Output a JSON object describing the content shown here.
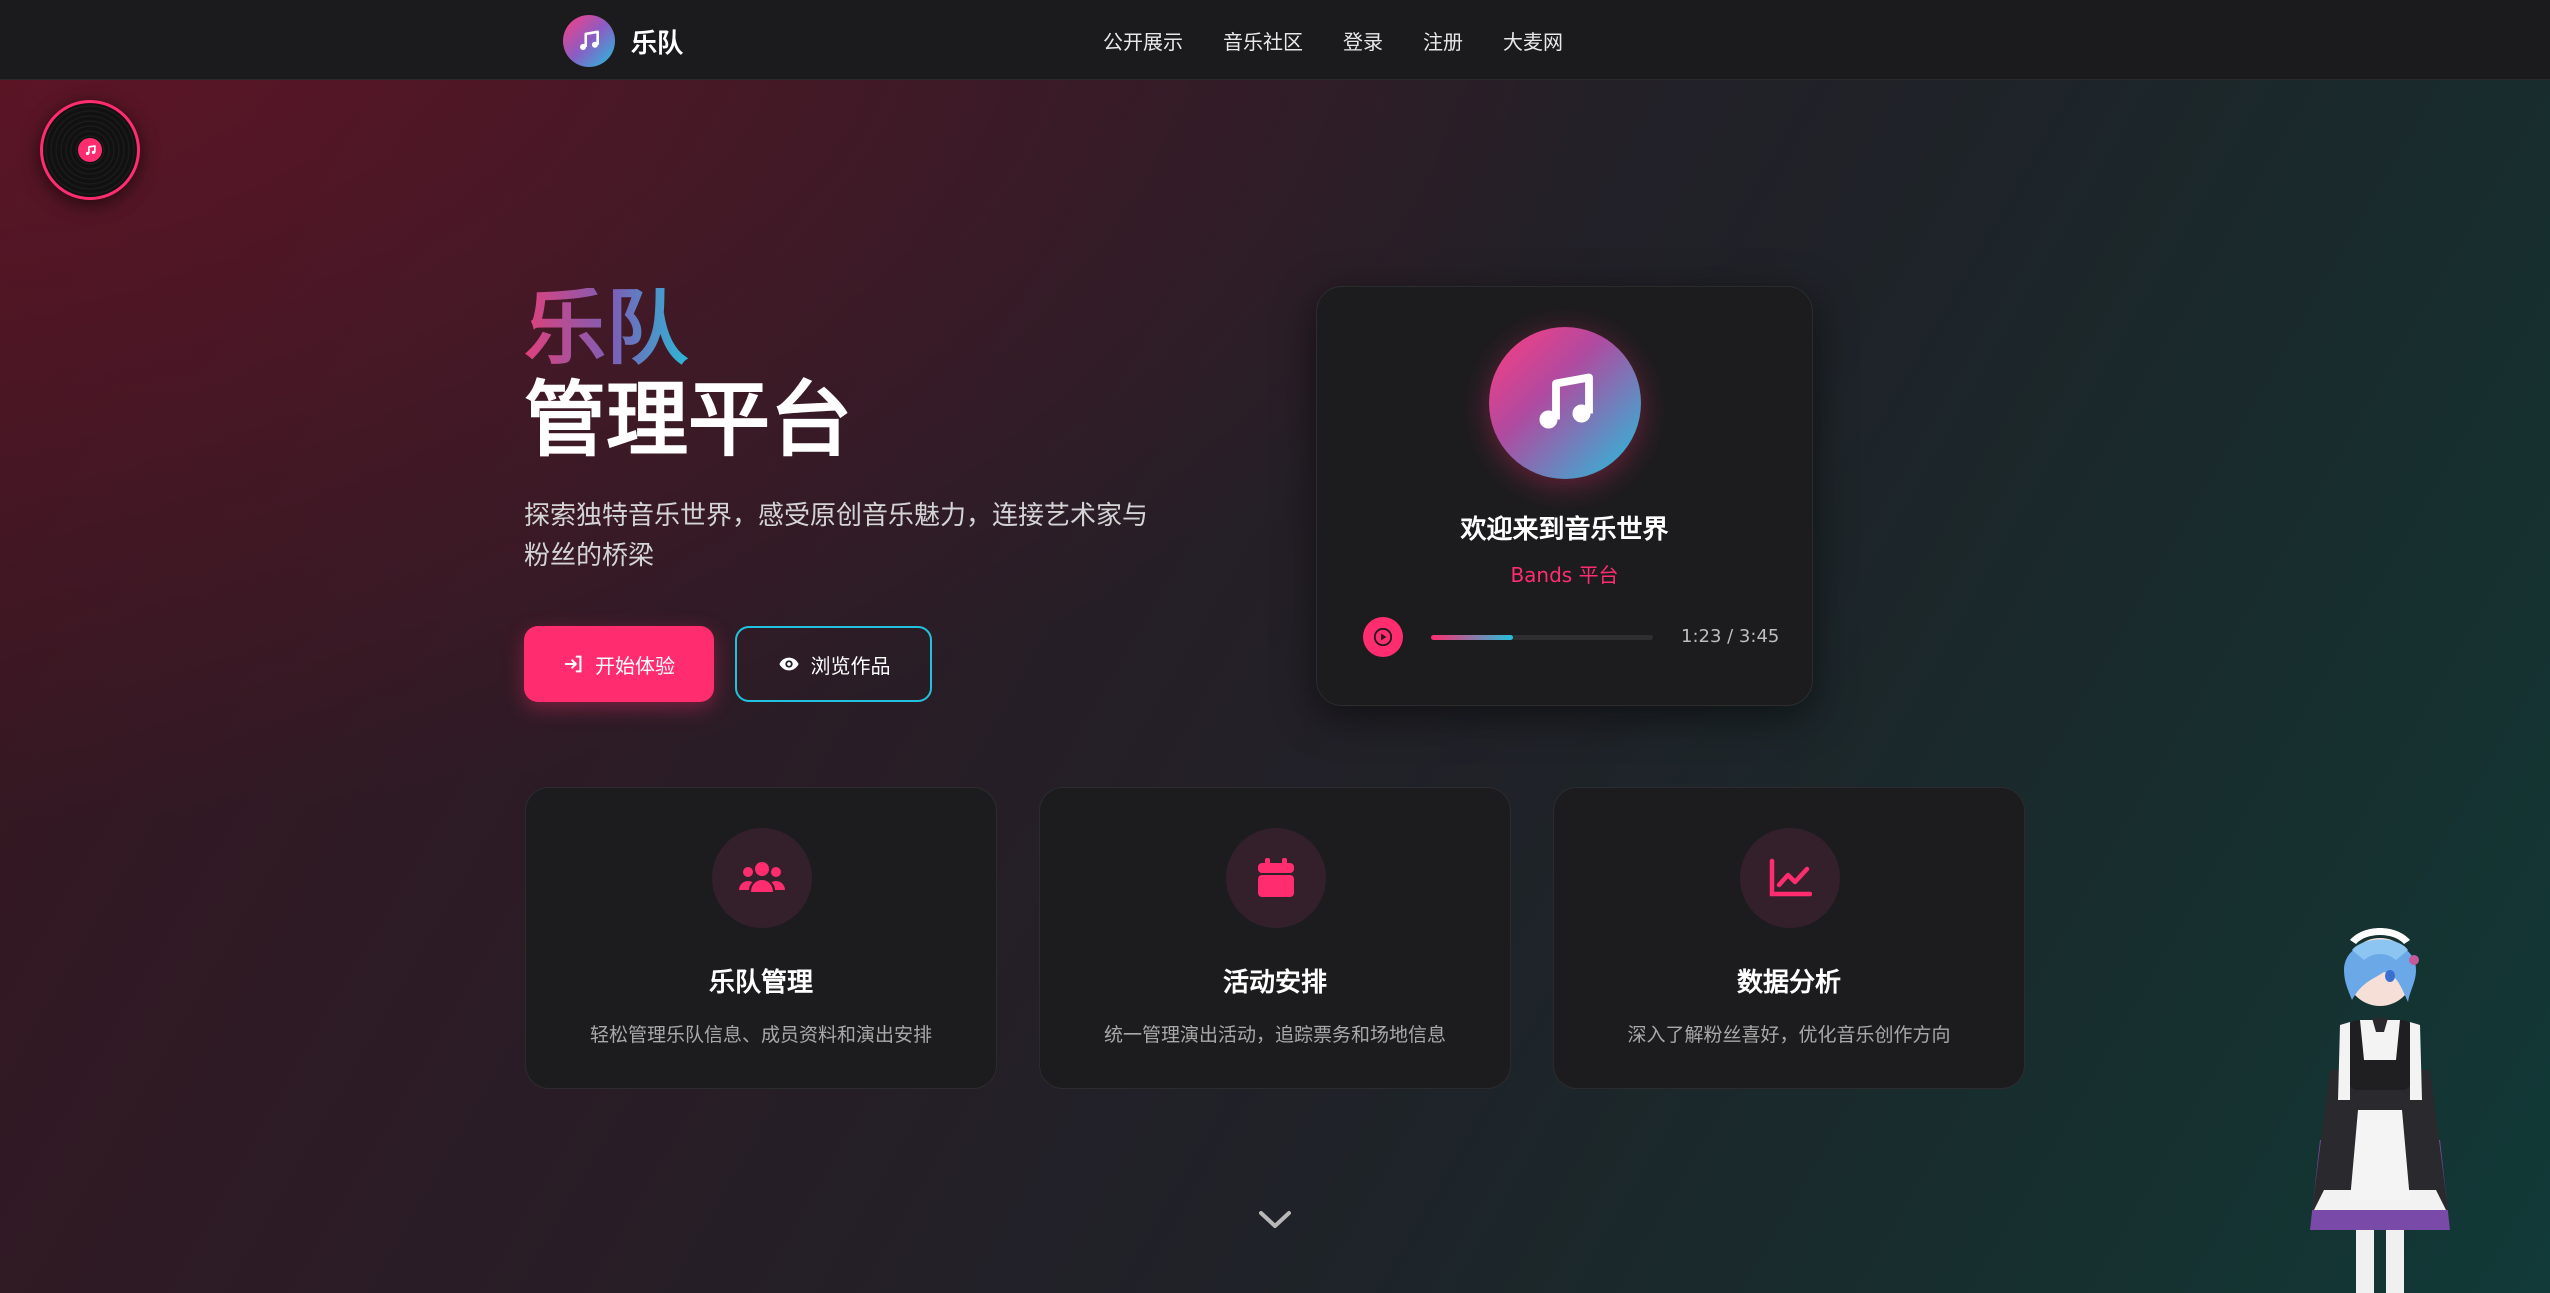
{
  "brand": {
    "name": "乐队",
    "icon": "music-note-icon"
  },
  "nav": {
    "links": [
      "公开展示",
      "音乐社区",
      "登录",
      "注册",
      "大麦网"
    ]
  },
  "hero": {
    "title_line1": "乐队",
    "title_line2": "管理平台",
    "description": "探索独特音乐世界，感受原创音乐魅力，连接艺术家与粉丝的桥梁",
    "primary_button": {
      "label": "开始体验",
      "icon": "sign-in-icon"
    },
    "secondary_button": {
      "label": "浏览作品",
      "icon": "eye-icon"
    }
  },
  "player": {
    "title": "欢迎来到音乐世界",
    "subtitle": "Bands 平台",
    "time": "1:23 / 3:45",
    "progress": 0.37,
    "cover_icon": "music-note-icon"
  },
  "features": [
    {
      "icon": "users-icon",
      "title": "乐队管理",
      "description": "轻松管理乐队信息、成员资料和演出安排"
    },
    {
      "icon": "calendar-icon",
      "title": "活动安排",
      "description": "统一管理演出活动，追踪票务和场地信息"
    },
    {
      "icon": "chart-line-icon",
      "title": "数据分析",
      "description": "深入了解粉丝喜好，优化音乐创作方向"
    }
  ],
  "colors": {
    "accent": "#ff2d6f",
    "accent_secondary": "#22c1dd",
    "card_bg": "#1c1c1e",
    "navbar_bg": "#1b1b1d"
  }
}
